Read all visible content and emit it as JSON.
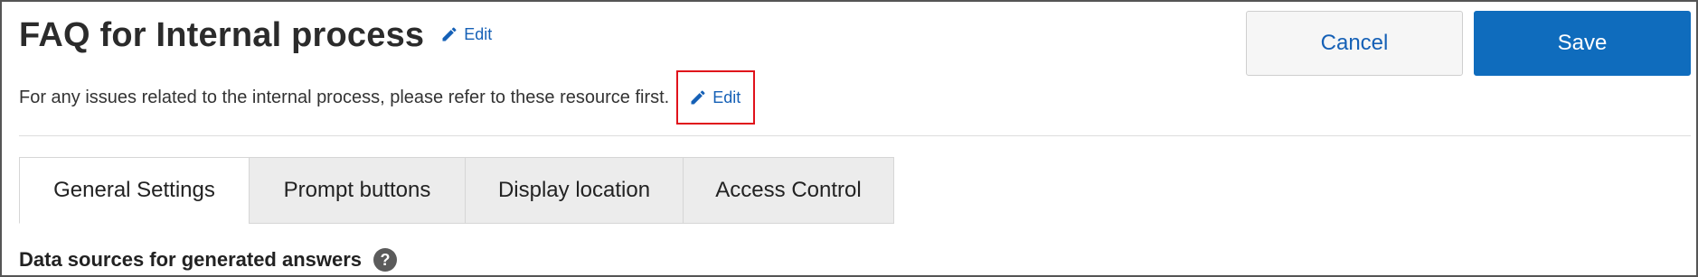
{
  "header": {
    "title": "FAQ for Internal process",
    "title_edit_label": "Edit",
    "description": "For any issues related to the internal process, please refer to these resource first.",
    "description_edit_label": "Edit"
  },
  "actions": {
    "cancel_label": "Cancel",
    "save_label": "Save"
  },
  "tabs": [
    {
      "label": "General Settings",
      "active": true
    },
    {
      "label": "Prompt buttons",
      "active": false
    },
    {
      "label": "Display location",
      "active": false
    },
    {
      "label": "Access Control",
      "active": false
    }
  ],
  "section": {
    "title": "Data sources for generated answers",
    "help_icon": "question-circle-icon",
    "help_glyph": "?"
  },
  "colors": {
    "link": "#1560b6",
    "primary": "#0f6cbd",
    "highlight_box": "#e0121b"
  }
}
